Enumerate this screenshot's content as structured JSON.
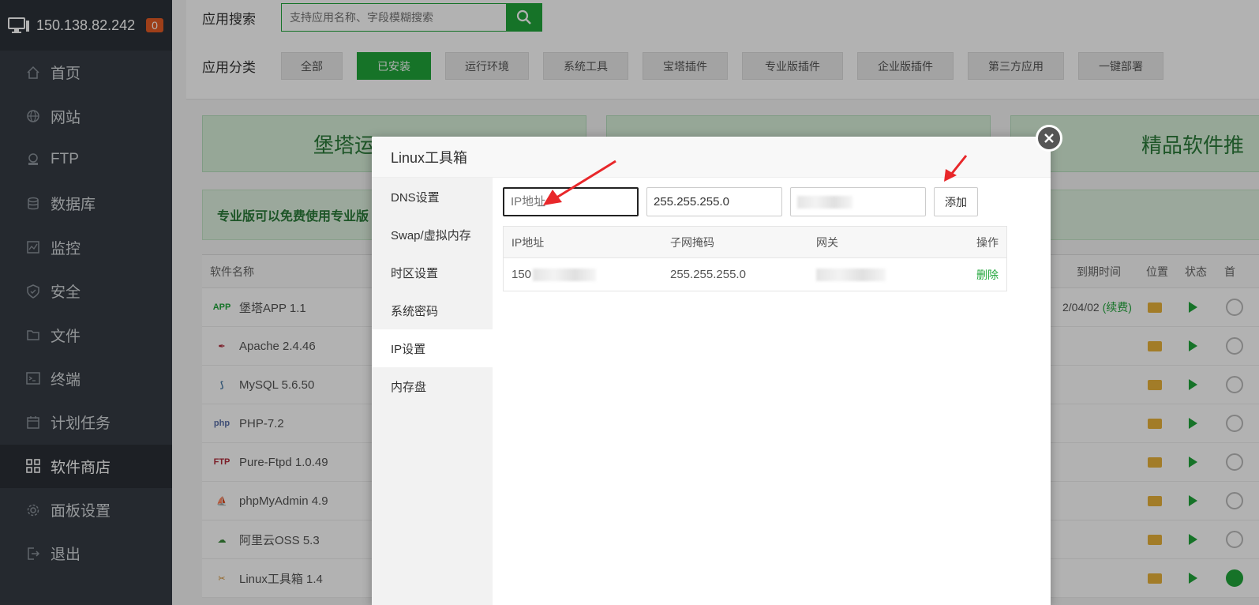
{
  "sidebar": {
    "host": "150.138.82.242",
    "badge": "0",
    "items": [
      {
        "label": "首页",
        "icon": "home-icon"
      },
      {
        "label": "网站",
        "icon": "globe-icon"
      },
      {
        "label": "FTP",
        "icon": "ftp-icon"
      },
      {
        "label": "数据库",
        "icon": "database-icon"
      },
      {
        "label": "监控",
        "icon": "monitor-chart-icon"
      },
      {
        "label": "安全",
        "icon": "shield-icon"
      },
      {
        "label": "文件",
        "icon": "folder-icon"
      },
      {
        "label": "终端",
        "icon": "terminal-icon"
      },
      {
        "label": "计划任务",
        "icon": "calendar-icon"
      },
      {
        "label": "软件商店",
        "icon": "grid-icon"
      },
      {
        "label": "面板设置",
        "icon": "gear-icon"
      },
      {
        "label": "退出",
        "icon": "logout-icon"
      }
    ]
  },
  "search": {
    "label": "应用搜索",
    "placeholder": "支持应用名称、字段模糊搜索"
  },
  "categories": {
    "label": "应用分类",
    "items": [
      "全部",
      "已安装",
      "运行环境",
      "系统工具",
      "宝塔插件",
      "专业版插件",
      "企业版插件",
      "第三方应用",
      "一键部署"
    ]
  },
  "banners": {
    "left": "堡塔运",
    "right": "精品软件推"
  },
  "promo": "专业版可以免费使用专业版",
  "table": {
    "headers": {
      "name": "软件名称",
      "expire": "到期时间",
      "location": "位置",
      "status": "状态",
      "home": "首"
    },
    "rows": [
      {
        "name": "堡塔APP 1.1",
        "icon": "app-icon",
        "expire": "2/04/02",
        "renew": "(续费)"
      },
      {
        "name": "Apache 2.4.46",
        "icon": "feather-icon"
      },
      {
        "name": "MySQL 5.6.50",
        "icon": "dolphin-icon"
      },
      {
        "name": "PHP-7.2",
        "icon": "php-icon"
      },
      {
        "name": "Pure-Ftpd 1.0.49",
        "icon": "ftp-logo-icon"
      },
      {
        "name": "phpMyAdmin 4.9",
        "icon": "sailboat-icon"
      },
      {
        "name": "阿里云OSS 5.3",
        "icon": "cloud-icon"
      },
      {
        "name": "Linux工具箱 1.4",
        "icon": "tools-icon"
      }
    ]
  },
  "modal": {
    "title": "Linux工具箱",
    "menu": [
      "DNS设置",
      "Swap/虚拟内存",
      "时区设置",
      "系统密码",
      "IP设置",
      "内存盘"
    ],
    "active_menu": "IP设置",
    "form": {
      "ip_placeholder": "IP地址",
      "netmask_value": "255.255.255.0",
      "gateway_value": "",
      "add_label": "添加"
    },
    "ip_table": {
      "headers": [
        "IP地址",
        "子网掩码",
        "网关",
        "操作"
      ],
      "rows": [
        {
          "ip": "150",
          "netmask": "255.255.255.0",
          "action": "删除"
        }
      ]
    }
  },
  "colors": {
    "accent": "#20a53a",
    "sidebar_bg": "#363c44",
    "badge": "#e25b25",
    "arrow": "#e8272a"
  }
}
